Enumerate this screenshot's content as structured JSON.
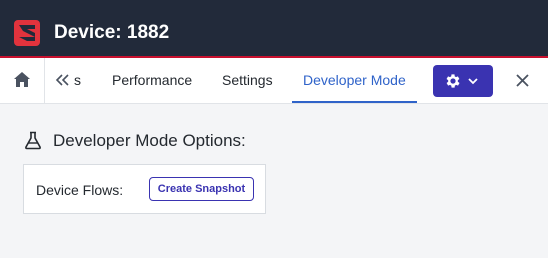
{
  "app": {
    "title": "Device: 1882",
    "logo_icon": "arrow-logo-icon",
    "accent_color": "#c8102e",
    "header_bg": "#222a3a"
  },
  "tabs": {
    "home_icon": "home-icon",
    "scroll_icon": "double-chevron-left-icon",
    "partial_label": "s",
    "items": [
      {
        "label": "Performance",
        "active": false
      },
      {
        "label": "Settings",
        "active": false
      },
      {
        "label": "Developer Mode",
        "active": true
      }
    ],
    "active_color": "#2f63c9",
    "menu_icon": "gear-icon",
    "menu_chevron_icon": "chevron-down-icon",
    "menu_color": "#3a33b1",
    "close_icon": "close-icon"
  },
  "main": {
    "heading": "Developer Mode Options:",
    "heading_icon": "flask-icon",
    "panel": {
      "label": "Device Flows:",
      "button_label": "Create Snapshot"
    }
  }
}
